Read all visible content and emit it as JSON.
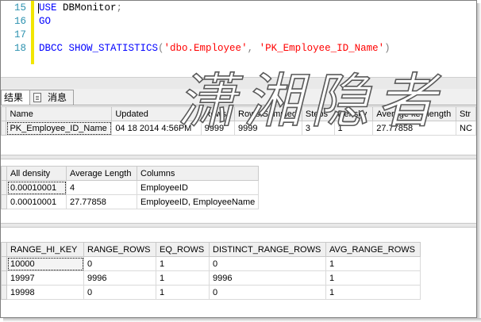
{
  "editor": {
    "lines": [
      {
        "num": "15",
        "parts": [
          {
            "t": "USE",
            "c": "kw"
          },
          {
            "t": " DBMonitor",
            "c": "id"
          },
          {
            "t": ";",
            "c": "pn"
          }
        ]
      },
      {
        "num": "16",
        "parts": [
          {
            "t": "GO",
            "c": "kw"
          }
        ]
      },
      {
        "num": "17",
        "parts": []
      },
      {
        "num": "18",
        "parts": [
          {
            "t": "DBCC SHOW_STATISTICS",
            "c": "kw"
          },
          {
            "t": "(",
            "c": "pn"
          },
          {
            "t": "'dbo.Employee'",
            "c": "str"
          },
          {
            "t": ", ",
            "c": "pn"
          },
          {
            "t": "'PK_Employee_ID_Name'",
            "c": "str"
          },
          {
            "t": ")",
            "c": "pn"
          }
        ]
      }
    ]
  },
  "tabs": {
    "results": "结果",
    "messages": "消息"
  },
  "watermark": "潇湘隐者",
  "header_grid": {
    "columns": [
      "Name",
      "Updated",
      "Rows",
      "Rows Sampled",
      "Steps",
      "Density",
      "Average key length",
      "Str"
    ],
    "rows": [
      [
        "PK_Employee_ID_Name",
        "04 18 2014  4:56PM",
        "9999",
        "9999",
        "3",
        "1",
        "27.77858",
        "NC"
      ]
    ]
  },
  "density_grid": {
    "columns": [
      "All density",
      "Average Length",
      "Columns"
    ],
    "rows": [
      [
        "0.00010001",
        "4",
        "EmployeeID"
      ],
      [
        "0.00010001",
        "27.77858",
        "EmployeeID, EmployeeName"
      ]
    ]
  },
  "histogram_grid": {
    "columns": [
      "RANGE_HI_KEY",
      "RANGE_ROWS",
      "EQ_ROWS",
      "DISTINCT_RANGE_ROWS",
      "AVG_RANGE_ROWS"
    ],
    "rows": [
      [
        "10000",
        "0",
        "1",
        "0",
        "1"
      ],
      [
        "19997",
        "9996",
        "1",
        "9996",
        "1"
      ],
      [
        "19998",
        "0",
        "1",
        "0",
        "1"
      ]
    ]
  },
  "colors": {
    "keyword": "#0000ff",
    "string": "#ff0000",
    "line_number": "#2b91af",
    "change_bar": "#f2e600"
  }
}
